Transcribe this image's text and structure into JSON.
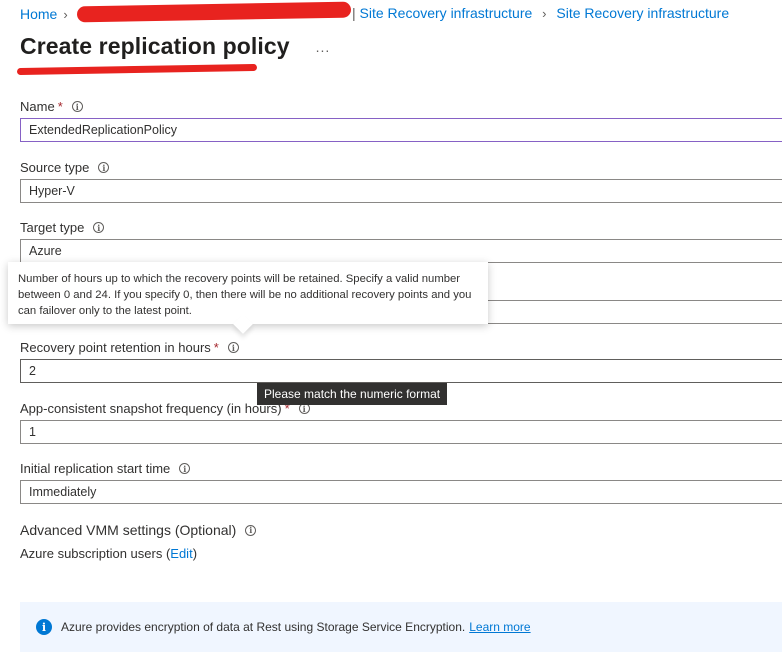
{
  "breadcrumb": {
    "home": "Home",
    "after": "Site Recovery infrastructure",
    "last": "Site Recovery infrastructure"
  },
  "page": {
    "title": "Create replication policy",
    "more": "..."
  },
  "fields": {
    "name": {
      "label": "Name",
      "value": "ExtendedReplicationPolicy"
    },
    "source_type": {
      "label": "Source type",
      "value": "Hyper-V"
    },
    "target_type": {
      "label": "Target type",
      "value": "Azure"
    },
    "retention": {
      "label": "Recovery point retention in hours",
      "value": "2"
    },
    "snapshot": {
      "label": "App-consistent snapshot frequency (in hours)",
      "value": "1"
    },
    "start_time": {
      "label": "Initial replication start time",
      "value": "Immediately"
    }
  },
  "required_marker": "*",
  "tooltip_info": "Number of hours up to which the recovery points will be retained. Specify a valid number between 0 and 24. If you specify 0, then there will be no additional recovery points and you can failover only to the latest point.",
  "tooltip_error": "Please match the numeric format",
  "advanced": {
    "label": "Advanced VMM settings (Optional)",
    "subscription_text": "Azure subscription users (",
    "edit_link": "Edit",
    "subscription_close": ")"
  },
  "banner": {
    "text": "Azure provides encryption of data at Rest using Storage Service Encryption.",
    "link": "Learn more"
  },
  "colors": {
    "accent": "#0078d4",
    "required": "#a4262c",
    "redaction": "#e8231f"
  }
}
